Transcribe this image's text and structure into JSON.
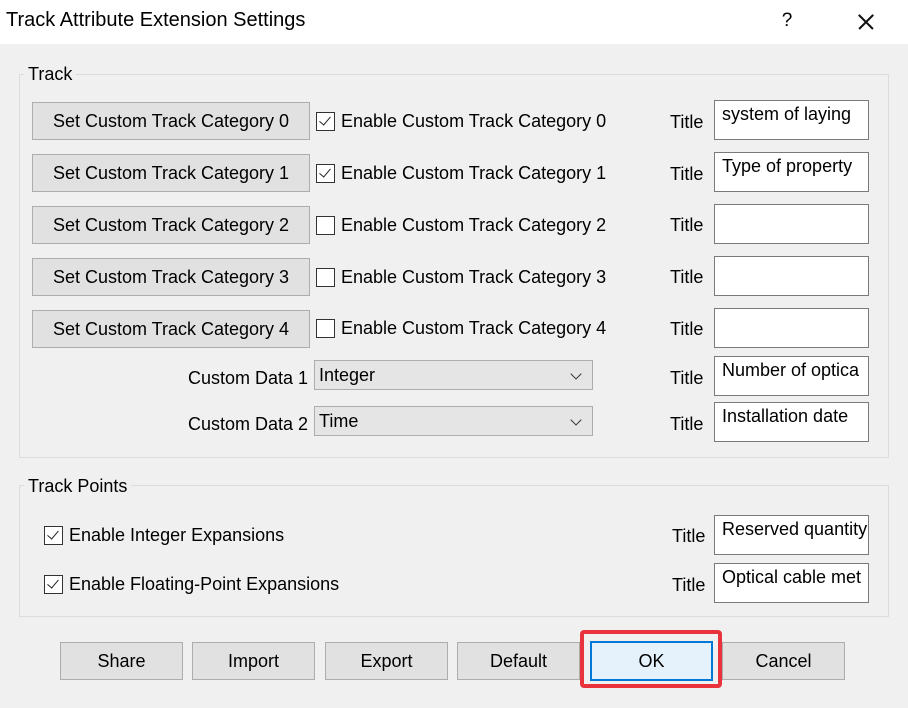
{
  "window": {
    "title": "Track Attribute Extension Settings",
    "help": "?"
  },
  "track": {
    "label": "Track",
    "rows": [
      {
        "button": "Set Custom Track Category 0",
        "checkbox": "Enable Custom Track Category 0",
        "checked": true,
        "title_label": "Title",
        "title_value": "system of laying"
      },
      {
        "button": "Set Custom Track Category 1",
        "checkbox": "Enable Custom Track Category 1",
        "checked": true,
        "title_label": "Title",
        "title_value": "Type of property"
      },
      {
        "button": "Set Custom Track Category 2",
        "checkbox": "Enable Custom Track Category 2",
        "checked": false,
        "title_label": "Title",
        "title_value": ""
      },
      {
        "button": "Set Custom Track Category 3",
        "checkbox": "Enable Custom Track Category 3",
        "checked": false,
        "title_label": "Title",
        "title_value": ""
      },
      {
        "button": "Set Custom Track Category 4",
        "checkbox": "Enable Custom Track Category 4",
        "checked": false,
        "title_label": "Title",
        "title_value": ""
      }
    ],
    "custom_data": [
      {
        "label": "Custom Data 1",
        "selected": "Integer",
        "title_label": "Title",
        "title_value": "Number of optica"
      },
      {
        "label": "Custom Data 2",
        "selected": "Time",
        "title_label": "Title",
        "title_value": "Installation date"
      }
    ]
  },
  "track_points": {
    "label": "Track Points",
    "rows": [
      {
        "checkbox": "Enable Integer Expansions",
        "checked": true,
        "title_label": "Title",
        "title_value": "Reserved quantity"
      },
      {
        "checkbox": "Enable Floating-Point Expansions",
        "checked": true,
        "title_label": "Title",
        "title_value": "Optical cable met"
      }
    ]
  },
  "buttons": {
    "share": "Share",
    "import": "Import",
    "export": "Export",
    "default": "Default",
    "ok": "OK",
    "cancel": "Cancel"
  },
  "colors": {
    "highlight": "#e8323c",
    "ok_border": "#0078d7"
  }
}
